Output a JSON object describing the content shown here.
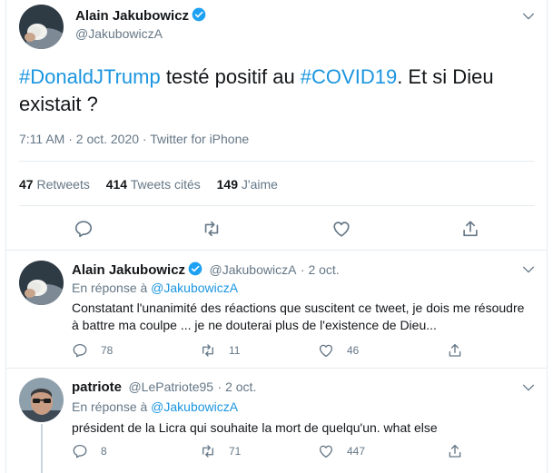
{
  "main_tweet": {
    "author_name": "Alain Jakubowicz",
    "author_handle": "@JakubowiczA",
    "text_parts": {
      "hashtag1": "#DonaldJTrump",
      "middle": " testé positif au ",
      "hashtag2": "#COVID19",
      "rest": ". Et si Dieu existait ?"
    },
    "timestamp": "7:11 AM · 2 oct. 2020 · Twitter for iPhone",
    "stats": {
      "retweets_count": "47",
      "retweets_label": "Retweets",
      "quotes_count": "414",
      "quotes_label": "Tweets cités",
      "likes_count": "149",
      "likes_label": "J'aime"
    },
    "actions": [
      "reply-icon",
      "retweet-icon",
      "like-icon",
      "share-icon"
    ]
  },
  "replies": [
    {
      "author_name": "Alain Jakubowicz",
      "author_handle": "@JakubowiczA",
      "time": "2 oct.",
      "reply_prefix": "En réponse à ",
      "reply_to": "@JakubowiczA",
      "text": "Constatant l'unanimité des réactions que suscitent ce tweet,  je dois me résoudre à battre ma coulpe ... je ne douterai plus de l'existence de Dieu...",
      "reply_count": "78",
      "retweet_count": "11",
      "like_count": "46"
    },
    {
      "author_name": "patriote",
      "author_handle": "@LePatriote95",
      "time": "2 oct.",
      "reply_prefix": "En réponse à ",
      "reply_to": "@JakubowiczA",
      "text": "président de la Licra qui souhaite la mort de quelqu'un. what else",
      "reply_count": "8",
      "retweet_count": "71",
      "like_count": "447"
    }
  ],
  "colors": {
    "link": "#1b95e0",
    "muted": "#657786",
    "divider": "#e6ecf0",
    "verified": "#1da1f2"
  }
}
